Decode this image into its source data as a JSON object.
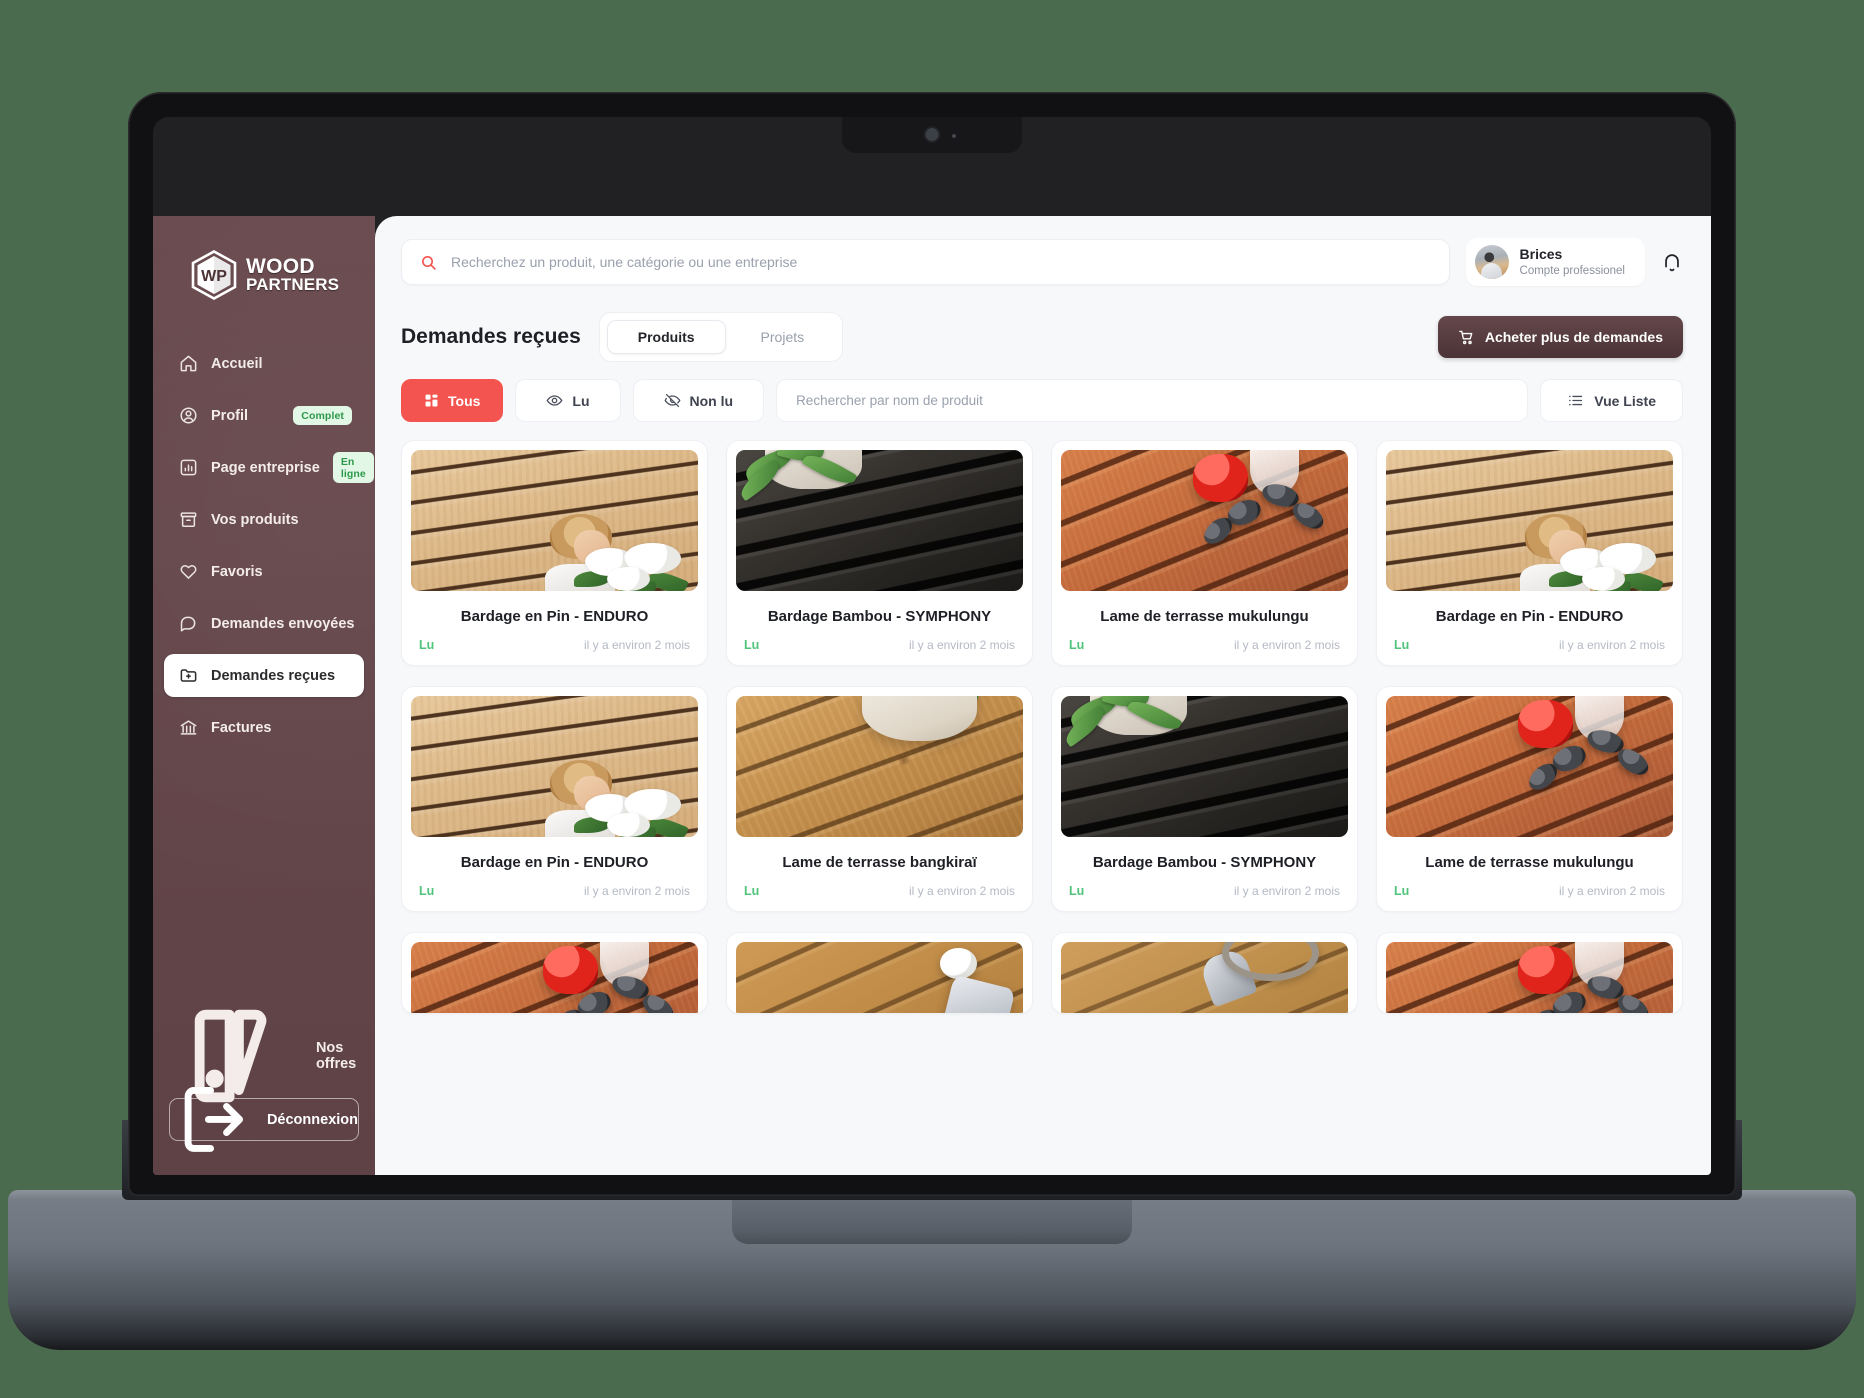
{
  "brand": {
    "mark": "WP",
    "line1": "WOOD",
    "line2": "PARTNERS"
  },
  "sidebar": {
    "items": [
      {
        "label": "Accueil",
        "icon": "home-icon",
        "badge": null,
        "active": false
      },
      {
        "label": "Profil",
        "icon": "user-icon",
        "badge": "Complet",
        "active": false
      },
      {
        "label": "Page entreprise",
        "icon": "chart-icon",
        "badge": "En ligne",
        "active": false
      },
      {
        "label": "Vos produits",
        "icon": "box-icon",
        "badge": null,
        "active": false
      },
      {
        "label": "Favoris",
        "icon": "heart-icon",
        "badge": null,
        "active": false
      },
      {
        "label": "Demandes envoyées",
        "icon": "chat-icon",
        "badge": null,
        "active": false
      },
      {
        "label": "Demandes reçues",
        "icon": "folder-plus-icon",
        "badge": null,
        "active": true
      },
      {
        "label": "Factures",
        "icon": "bank-icon",
        "badge": null,
        "active": false
      }
    ],
    "offers_label": "Nos offres",
    "logout_label": "Déconnexion"
  },
  "topbar": {
    "search_placeholder": "Recherchez un produit, une catégorie ou une entreprise",
    "search_value": "",
    "user_name": "Brices",
    "user_subtitle": "Compte professionel"
  },
  "header": {
    "title": "Demandes reçues",
    "tabs": [
      {
        "label": "Produits",
        "active": true
      },
      {
        "label": "Projets",
        "active": false
      }
    ],
    "buy_label": "Acheter plus de demandes"
  },
  "filters": {
    "chips": [
      {
        "label": "Tous",
        "icon": "grid-icon",
        "active": true
      },
      {
        "label": "Lu",
        "icon": "eye-icon",
        "active": false
      },
      {
        "label": "Non lu",
        "icon": "eye-off-icon",
        "active": false
      }
    ],
    "name_search_placeholder": "Rechercher par nom de produit",
    "name_search_value": "",
    "view_label": "Vue Liste"
  },
  "colors": {
    "accent_red": "#f4544f",
    "sidebar_brown": "#63464a",
    "buy_button": "#4b3336",
    "status_read": "#4fc47a",
    "badge_green_bg": "#e2f7e6",
    "badge_green_text": "#2c9a4a",
    "page_bg": "#f7f8fa",
    "desktop_bg": "#4a6b4e"
  },
  "cards": [
    {
      "title": "Bardage en Pin - ENDURO",
      "status": "Lu",
      "time": "il y a environ 2 mois",
      "img": "pine"
    },
    {
      "title": "Bardage Bambou - SYMPHONY",
      "status": "Lu",
      "time": "il y a environ 2 mois",
      "img": "bamboo"
    },
    {
      "title": "Lame de terrasse mukulungu",
      "status": "Lu",
      "time": "il y a environ 2 mois",
      "img": "mukulungu"
    },
    {
      "title": "Bardage en Pin - ENDURO",
      "status": "Lu",
      "time": "il y a environ 2 mois",
      "img": "pine"
    },
    {
      "title": "Bardage en Pin - ENDURO",
      "status": "Lu",
      "time": "il y a environ 2 mois",
      "img": "pine"
    },
    {
      "title": "Lame de terrasse bangkiraï",
      "status": "Lu",
      "time": "il y a environ 2 mois",
      "img": "bangkirai"
    },
    {
      "title": "Bardage Bambou - SYMPHONY",
      "status": "Lu",
      "time": "il y a environ 2 mois",
      "img": "bamboo"
    },
    {
      "title": "Lame de terrasse mukulungu",
      "status": "Lu",
      "time": "il y a environ 2 mois",
      "img": "mukulungu"
    }
  ],
  "cards_partial": [
    {
      "img": "mukulungu"
    },
    {
      "img": "golf"
    },
    {
      "img": "rope"
    },
    {
      "img": "mukulungu"
    }
  ]
}
